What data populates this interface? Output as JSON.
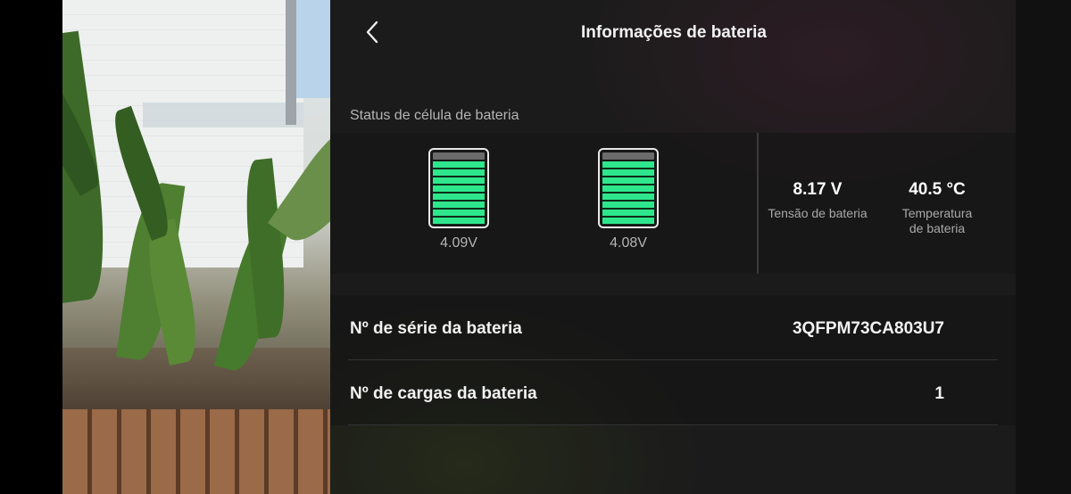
{
  "header": {
    "title": "Informações de bateria",
    "back_icon": "chevron-left-icon"
  },
  "cells_section": {
    "label": "Status de célula de bateria",
    "cells": [
      {
        "voltage": "4.09V",
        "fill_fraction": 1.0
      },
      {
        "voltage": "4.08V",
        "fill_fraction": 1.0
      }
    ],
    "cell_color": "#2ee68c"
  },
  "stats": {
    "voltage": {
      "value": "8.17 V",
      "label": "Tensão de bateria"
    },
    "temperature": {
      "value": "40.5 °C",
      "label_line1": "Temperatura",
      "label_line2": "de bateria"
    }
  },
  "info_rows": [
    {
      "key": "Nº de série da bateria",
      "value": "3QFPM73CA803U7"
    },
    {
      "key": "Nº de cargas da bateria",
      "value": "1"
    }
  ]
}
